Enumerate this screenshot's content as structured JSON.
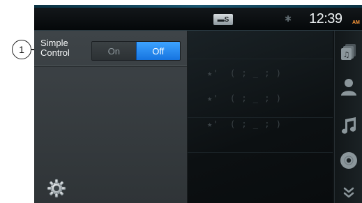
{
  "callout": {
    "number": "1"
  },
  "statusbar": {
    "source_badge": "▬S",
    "bluetooth_icon": "bluetooth-icon",
    "clock": "12:39",
    "ampm": "AM"
  },
  "settings": {
    "label_line1": "Simple",
    "label_line2": "Control",
    "options": [
      "On",
      "Off"
    ],
    "selected": "Off"
  },
  "list_items": [
    "★'  ( ; _ ; )",
    "★'  ( ; _ ; )",
    "★'  ( ; _ ; )"
  ],
  "sidebar_icons": [
    "playlists-icon",
    "artist-icon",
    "song-icon",
    "album-icon",
    "more-icon"
  ],
  "colors": {
    "accent": "#1e88ff",
    "clock_ampm": "#ff9a3a",
    "panel": "#3a4043"
  }
}
